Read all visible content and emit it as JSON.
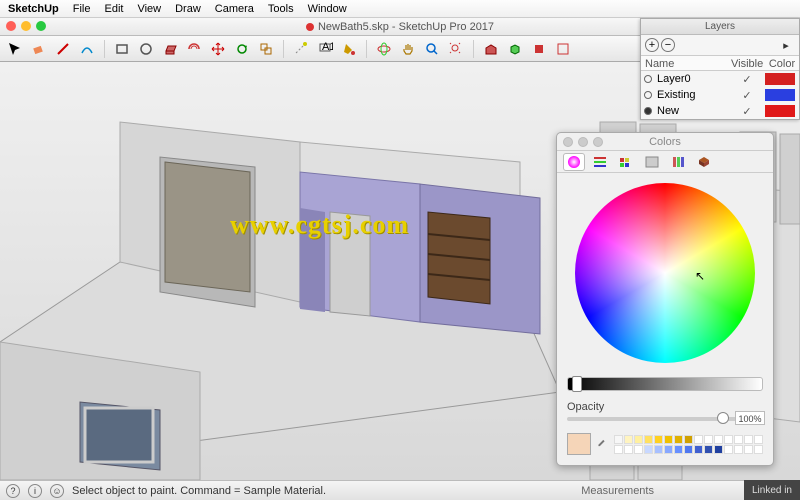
{
  "menubar": {
    "app": "SketchUp",
    "items": [
      "File",
      "Edit",
      "View",
      "Draw",
      "Camera",
      "Tools",
      "Window"
    ]
  },
  "window": {
    "title": "NewBath5.skp - SketchUp Pro 2017"
  },
  "status": {
    "hint": "Select object to paint. Command = Sample Material.",
    "measurements_label": "Measurements",
    "brand": "Linked in"
  },
  "layers": {
    "title": "Layers",
    "cols": {
      "name": "Name",
      "visible": "Visible",
      "color": "Color"
    },
    "rows": [
      {
        "name": "Layer0",
        "visible": "✓",
        "color": "#d42020",
        "selected": false
      },
      {
        "name": "Existing",
        "visible": "✓",
        "color": "#2a3fe0",
        "selected": false
      },
      {
        "name": "New",
        "visible": "✓",
        "color": "#e01818",
        "selected": true
      }
    ]
  },
  "colors": {
    "title": "Colors",
    "opacity_label": "Opacity",
    "opacity_value": "100%",
    "swatch": "#f5d5b8",
    "mini": [
      "#f7f7f7",
      "#fff4c0",
      "#fff0a0",
      "#ffe060",
      "#ffd020",
      "#f0c000",
      "#e0b000",
      "#d0a000",
      "#fff",
      "#fff",
      "#fff",
      "#fff",
      "#fff",
      "#fff",
      "#fff",
      "#fff",
      "#fff",
      "#fff",
      "#c8d8ff",
      "#a8c0ff",
      "#88a8ff",
      "#6890ff",
      "#5078f0",
      "#4060d0",
      "#3050b0",
      "#2040a0",
      "#fff",
      "#fff",
      "#fff",
      "#fff"
    ]
  },
  "watermark": "www.cgtsj.com"
}
